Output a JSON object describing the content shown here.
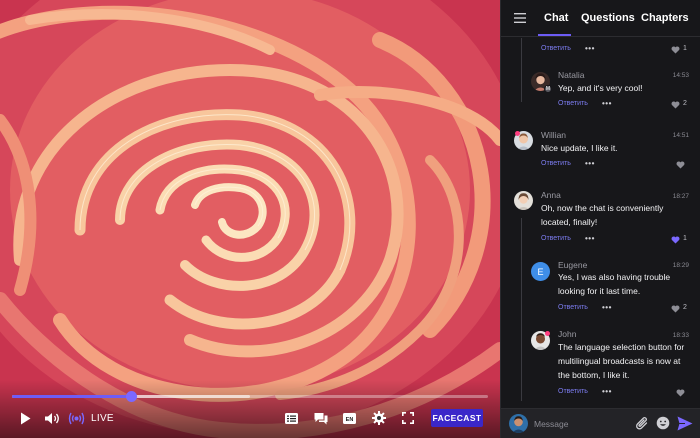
{
  "player": {
    "progress_fraction": 0.25,
    "buffered_fraction": 0.5,
    "live_label": "LIVE",
    "brand_button": "FACECAST",
    "accent_color": "#6f5cf6",
    "brand_color": "#3b27c9",
    "controls": [
      "play-icon",
      "volume-icon",
      "live-broadcast-icon",
      "list-icon",
      "chat-bubble-icon",
      "language-icon",
      "settings-gear-icon",
      "fullscreen-icon"
    ],
    "language_badge": "EN"
  },
  "panel": {
    "tabs": [
      {
        "label": "Chat",
        "active": true
      },
      {
        "label": "Questions",
        "active": false
      },
      {
        "label": "Chapters",
        "active": false
      }
    ],
    "reply_label": "Ответить",
    "more_label": "•••",
    "top_partial": {
      "likes": "1"
    },
    "messages": [
      {
        "name": "Natalia",
        "time": "14:53",
        "lines": [
          "Yep, and it's very cool!"
        ],
        "likes": "2",
        "liked": false,
        "nested": true
      },
      {
        "name": "Willian",
        "time": "14:51",
        "lines": [
          "Nice update, I like it."
        ],
        "likes": "",
        "liked": false,
        "nested": false
      },
      {
        "name": "Anna",
        "time": "18:27",
        "lines": [
          "Oh, now the chat is conveniently",
          "located, finally!"
        ],
        "likes": "1",
        "liked": true,
        "nested": false
      },
      {
        "name": "Eugene",
        "time": "18:29",
        "avatar_letter": "E",
        "lines": [
          "Yes, I was also having trouble",
          "looking for it last time."
        ],
        "likes": "2",
        "liked": false,
        "nested": true
      },
      {
        "name": "John",
        "time": "18:33",
        "lines": [
          "The language selection button for",
          "multilingual broadcasts is now at",
          "the bottom, I like it."
        ],
        "likes": "",
        "liked": false,
        "nested": true
      }
    ],
    "input": {
      "placeholder": "Message"
    }
  }
}
